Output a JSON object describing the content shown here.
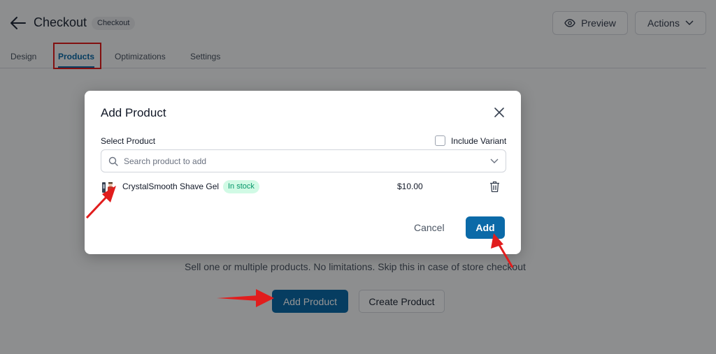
{
  "header": {
    "title": "Checkout",
    "badge": "Checkout",
    "preview_label": "Preview",
    "actions_label": "Actions"
  },
  "tabs": [
    {
      "label": "Design"
    },
    {
      "label": "Products"
    },
    {
      "label": "Optimizations"
    },
    {
      "label": "Settings"
    }
  ],
  "page": {
    "description": "Sell one or multiple products. No limitations. Skip this in case of store checkout",
    "add_product_label": "Add Product",
    "create_product_label": "Create Product"
  },
  "modal": {
    "title": "Add Product",
    "select_label": "Select Product",
    "include_variant_label": "Include Variant",
    "search_placeholder": "Search product to add",
    "product": {
      "name": "CrystalSmooth Shave Gel",
      "stock": "In stock",
      "price": "$10.00"
    },
    "cancel_label": "Cancel",
    "add_label": "Add"
  },
  "colors": {
    "accent": "#0b6aa8",
    "annotation": "#e11d1d",
    "stock_bg": "#d1fae5",
    "stock_text": "#059669"
  }
}
